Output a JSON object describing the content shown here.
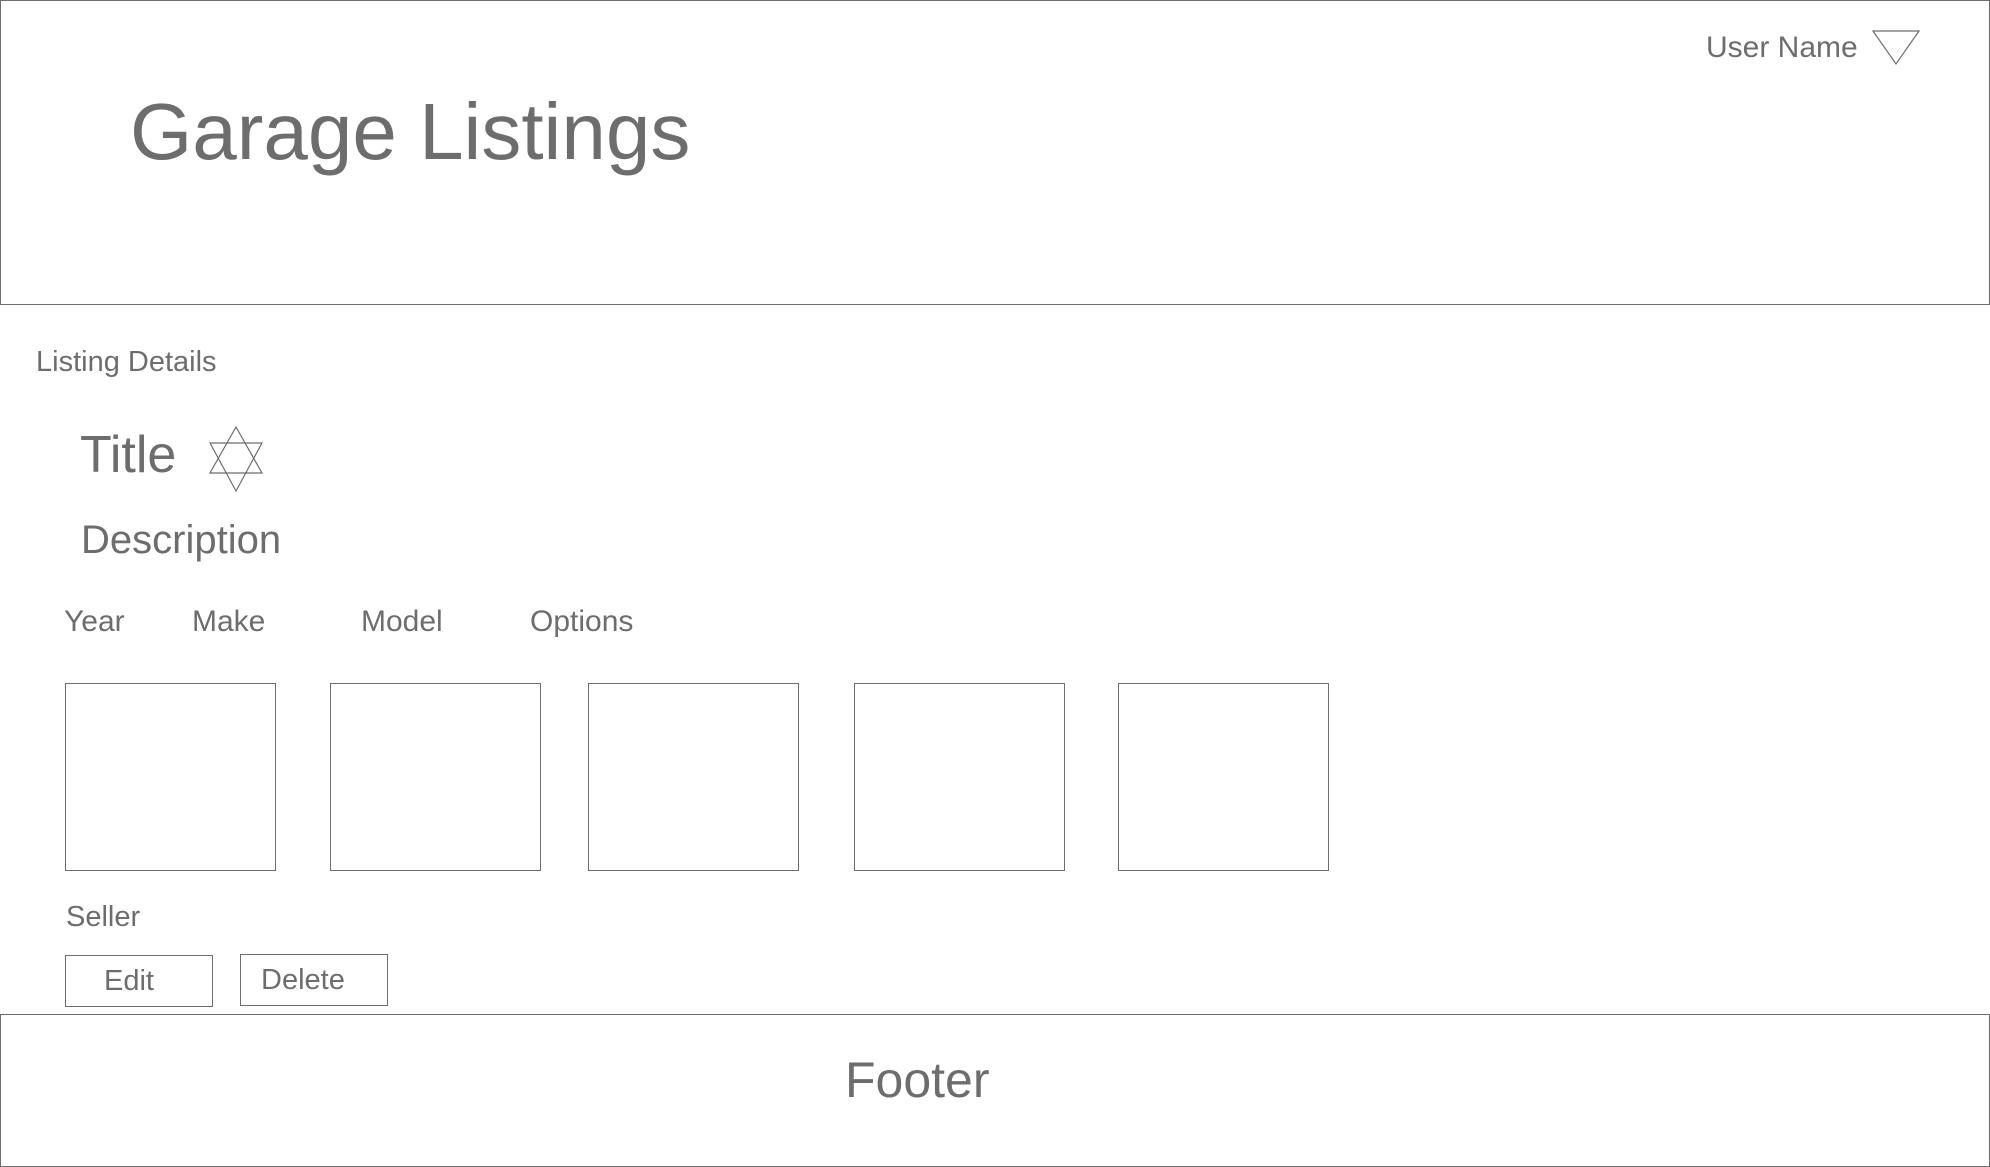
{
  "header": {
    "app_title": "Garage Listings",
    "user_menu": {
      "user_name": "User Name",
      "icon": "triangle-down-icon"
    }
  },
  "main": {
    "section_label": "Listing Details",
    "listing": {
      "title": "Title",
      "favorite_icon": "star-icon",
      "description": "Description",
      "specs": [
        "Year",
        "Make",
        "Model",
        "Options"
      ],
      "photo_count": 5,
      "seller": "Seller"
    },
    "actions": {
      "edit_label": "Edit",
      "delete_label": "Delete"
    }
  },
  "footer": {
    "label": "Footer"
  },
  "colors": {
    "stroke": "#6d6d6d",
    "background": "#ffffff"
  }
}
